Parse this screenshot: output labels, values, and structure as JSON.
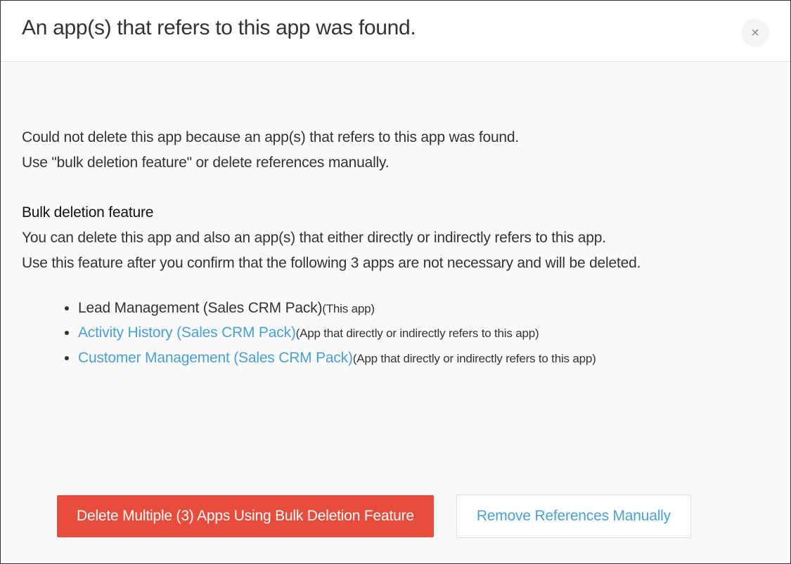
{
  "header": {
    "title": "An app(s) that refers to this app was found."
  },
  "body": {
    "intro_line1": "Could not delete this app because an app(s) that refers to this app was found.",
    "intro_line2": "Use \"bulk deletion feature\" or delete references manually.",
    "section_heading": "Bulk deletion feature",
    "section_desc_line1": "You can delete this app and also an app(s) that either directly or indirectly refers to this app.",
    "section_desc_line2": "Use this feature after you confirm that the following 3 apps are not necessary and will be deleted.",
    "apps": [
      {
        "name": "Lead Management (Sales CRM Pack)",
        "note": "(This app)",
        "is_link": false
      },
      {
        "name": "Activity History (Sales CRM Pack)",
        "note": "(App that directly or indirectly refers to this app)",
        "is_link": true
      },
      {
        "name": "Customer Management (Sales CRM Pack)",
        "note": "(App that directly or indirectly refers to this app)",
        "is_link": true
      }
    ]
  },
  "footer": {
    "bulk_delete_label": "Delete Multiple (3) Apps Using Bulk Deletion Feature",
    "remove_refs_label": "Remove References Manually"
  }
}
